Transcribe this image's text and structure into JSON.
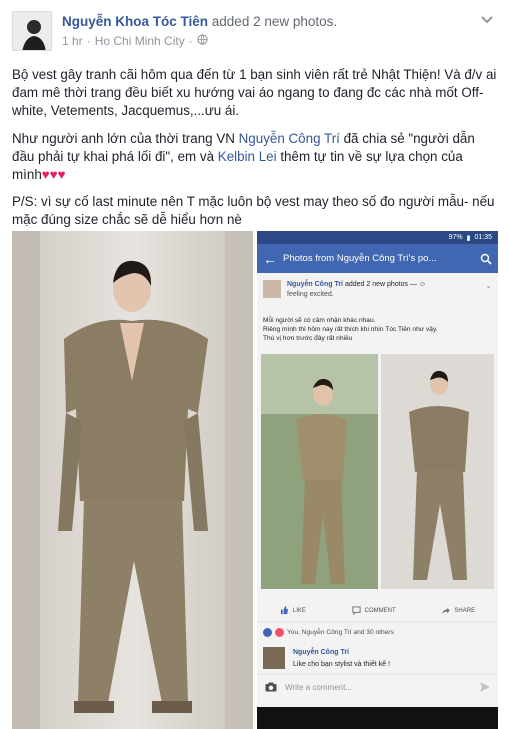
{
  "post": {
    "author": "Nguyễn Khoa Tóc Tiên",
    "action": "added 2 new photos.",
    "time": "1 hr",
    "separator": "·",
    "location": "Ho Chi Minh City",
    "separator2": "·"
  },
  "text": {
    "p1": "Bộ vest gây tranh cãi hôm qua đến từ 1 bạn sinh viên rất trẻ Nhật Thiện! Và đ/v ai đam mê thời trang đều biết xu hướng vai áo ngang to đang đc các nhà mốt Off-white, Vetements, Jacquemus,...ưu ái.",
    "p2_a": "Như người anh lớn của thời trang VN ",
    "p2_link1": "Nguyễn Công Trí",
    "p2_b": " đã chia sẻ \"người dẫn đầu phải tự khai phá lối đi\", em và ",
    "p2_link2": "Kelbin Lei",
    "p2_c": " thêm tự tin về sự lựa chọn của mình",
    "p2_hearts": "♥♥♥",
    "p3": "P/S: vì sự cố last minute nên T mặc luôn bộ vest may theo số đo người mẫu- nếu mặc đúng size chắc sẽ dễ hiểu hơn nè"
  },
  "screenshot": {
    "status": "97%",
    "clock": "01:35",
    "title": "Photos from Nguyễn Công Trí's po...",
    "inner_author": "Nguyễn Công Trí",
    "inner_action": "added 2 new photos — ",
    "inner_feeling": "feeling excited.",
    "inner_line1": "Mỗi người sẽ có cảm nhận khác nhau.",
    "inner_line2": "Riêng mình thì hôm nay rất thích khi nhìn Tóc Tiên như vậy.",
    "inner_line3": "Thú vị hơn trước đây rất nhiều",
    "like": "LIKE",
    "comment": "COMMENT",
    "share": "SHARE",
    "reactions": "You, Nguyễn Công Trí and 30 others",
    "comment_author": "Nguyễn Công Trí",
    "comment_text": "Like cho bạn stylist và thiết kế !",
    "write_placeholder": "Write a comment..."
  },
  "colors": {
    "link": "#365899",
    "fb_blue": "#4267b2",
    "heart": "#e0245e"
  }
}
